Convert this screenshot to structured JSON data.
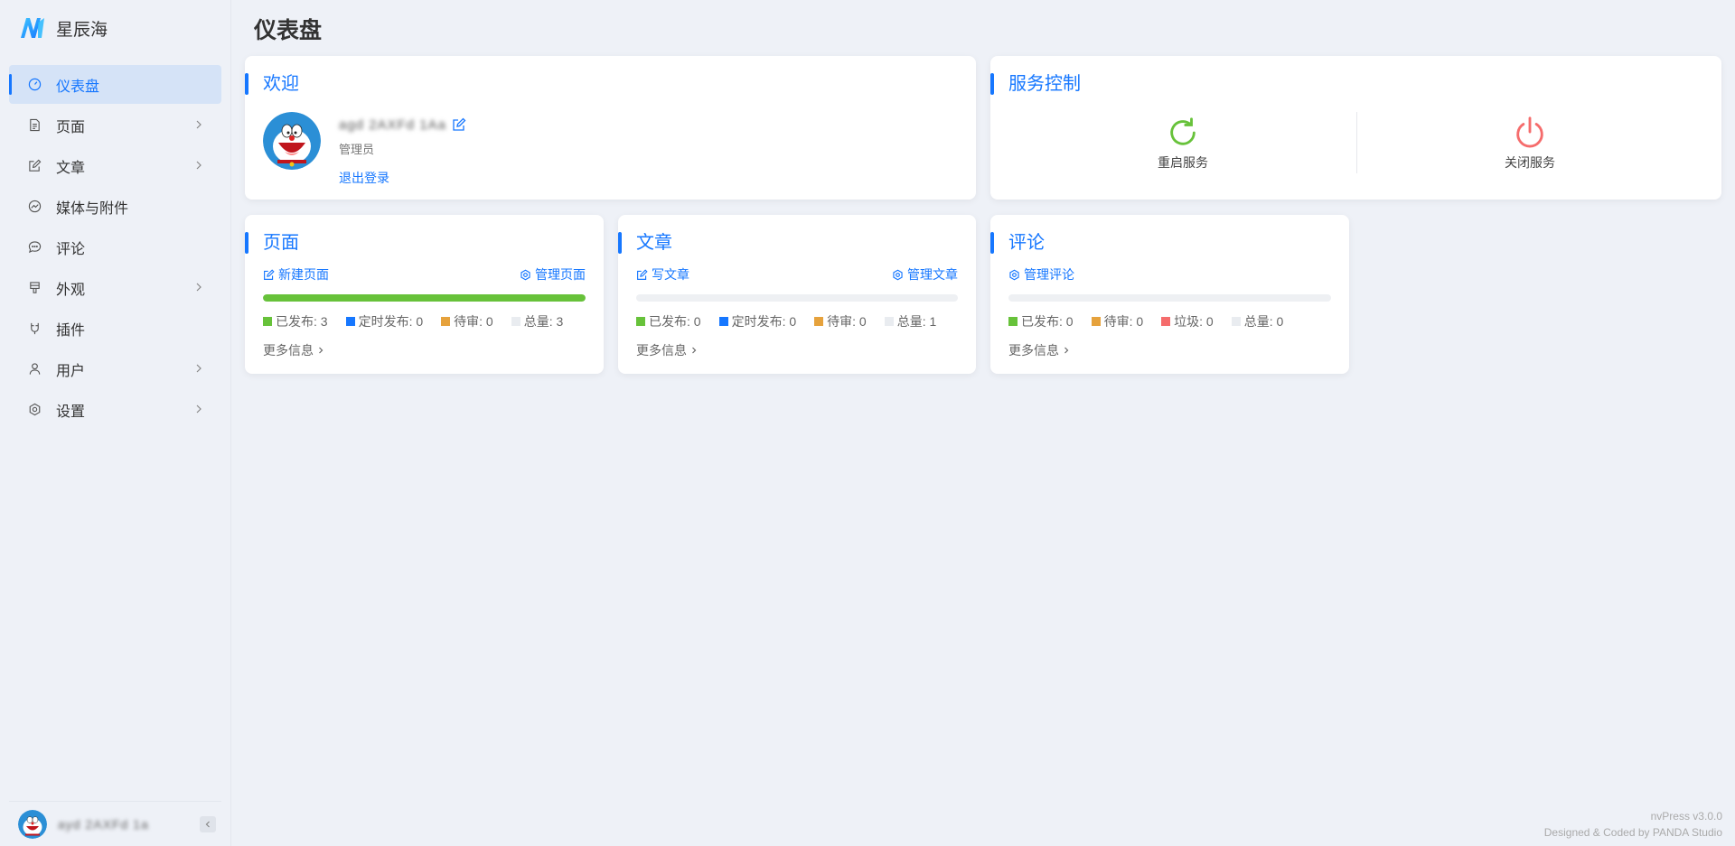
{
  "brand": {
    "name": "星辰海"
  },
  "sidebar": {
    "items": [
      {
        "label": "仪表盘",
        "icon": "dashboard-icon",
        "active": true
      },
      {
        "label": "页面",
        "icon": "page-icon"
      },
      {
        "label": "文章",
        "icon": "article-icon"
      },
      {
        "label": "媒体与附件",
        "icon": "media-icon"
      },
      {
        "label": "评论",
        "icon": "comment-icon"
      },
      {
        "label": "外观",
        "icon": "appearance-icon"
      },
      {
        "label": "插件",
        "icon": "plugin-icon"
      },
      {
        "label": "用户",
        "icon": "user-icon"
      },
      {
        "label": "设置",
        "icon": "settings-icon"
      }
    ],
    "footer_username": "ayd 2AXFd 1a"
  },
  "page_title": "仪表盘",
  "welcome": {
    "title": "欢迎",
    "username": "agd 2AXFd 1Aa",
    "role": "管理员",
    "logout": "退出登录"
  },
  "service": {
    "title": "服务控制",
    "restart": "重启服务",
    "shutdown": "关闭服务"
  },
  "pages_card": {
    "title": "页面",
    "new_link": "新建页面",
    "manage_link": "管理页面",
    "progress": 1.0,
    "published": "已发布: 3",
    "scheduled": "定时发布: 0",
    "pending": "待审: 0",
    "total": "总量: 3",
    "more": "更多信息"
  },
  "articles_card": {
    "title": "文章",
    "new_link": "写文章",
    "manage_link": "管理文章",
    "progress": 0,
    "published": "已发布: 0",
    "scheduled": "定时发布: 0",
    "pending": "待审: 0",
    "total": "总量: 1",
    "more": "更多信息"
  },
  "comments_card": {
    "title": "评论",
    "manage_link": "管理评论",
    "progress": 0,
    "published": "已发布: 0",
    "pending": "待审: 0",
    "spam": "垃圾: 0",
    "total": "总量: 0",
    "more": "更多信息"
  },
  "footer": {
    "version": "nvPress v3.0.0",
    "credit": "Designed & Coded by PANDA Studio"
  },
  "colors": {
    "accent": "#1677ff",
    "published": "#67c23a",
    "scheduled": "#1677ff",
    "pending": "#e6a23c",
    "spam": "#f56c6c",
    "total": "#e9ecf0"
  }
}
